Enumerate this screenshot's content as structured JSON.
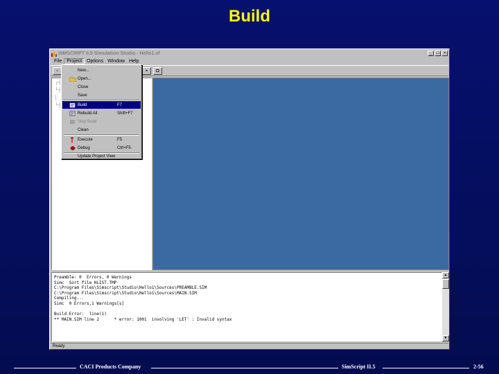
{
  "slide": {
    "title": "Build"
  },
  "window": {
    "title": "SIMSCRIPT II.5 Simulation Studio - Hello1.sf",
    "minimize": "_",
    "maximize": "□",
    "close": "×",
    "menu": [
      "File",
      "Project",
      "Options",
      "Window",
      "Help"
    ]
  },
  "project_menu": {
    "items": [
      {
        "label": "New...",
        "shortcut": "",
        "state": "normal"
      },
      {
        "label": "Open...",
        "shortcut": "",
        "state": "normal"
      },
      {
        "label": "Close",
        "shortcut": "",
        "state": "normal"
      },
      {
        "label": "Save",
        "shortcut": "",
        "state": "normal"
      },
      {
        "label": "Build",
        "shortcut": "F7",
        "state": "selected"
      },
      {
        "label": "Rebuild All",
        "shortcut": "Shift+F7",
        "state": "normal"
      },
      {
        "label": "Stop Build",
        "shortcut": "",
        "state": "disabled"
      },
      {
        "label": "Clean",
        "shortcut": "",
        "state": "normal"
      },
      {
        "label": "Execute",
        "shortcut": "F5",
        "state": "normal"
      },
      {
        "label": "Debug",
        "shortcut": "Ctrl+F5",
        "state": "normal"
      },
      {
        "label": "Update Project View",
        "shortcut": "",
        "state": "normal"
      }
    ]
  },
  "output": {
    "lines": [
      "Preamble: 0  Errors, 0 Warnings",
      "Simc  Sort file HLIST.TMP",
      "C:\\Program Files\\Simscript\\Studio\\Hello1\\Sources\\PREAMBLE.SIM",
      "C:\\Program Files\\Simscript\\Studio\\Hello1\\Sources\\MAIN.SIM",
      "Compiling...",
      "Simc  0 Errors,1 Warnings[s]",
      "",
      "Build Error:  line(1)",
      "** MAIN.SIM line 2      * error: 1001  involving 'LET' : Invalid syntax"
    ]
  },
  "status": {
    "text": "Ready"
  },
  "footer": {
    "left": "CACI Products Company",
    "center": "SimScript II.5",
    "right": "2-56"
  }
}
